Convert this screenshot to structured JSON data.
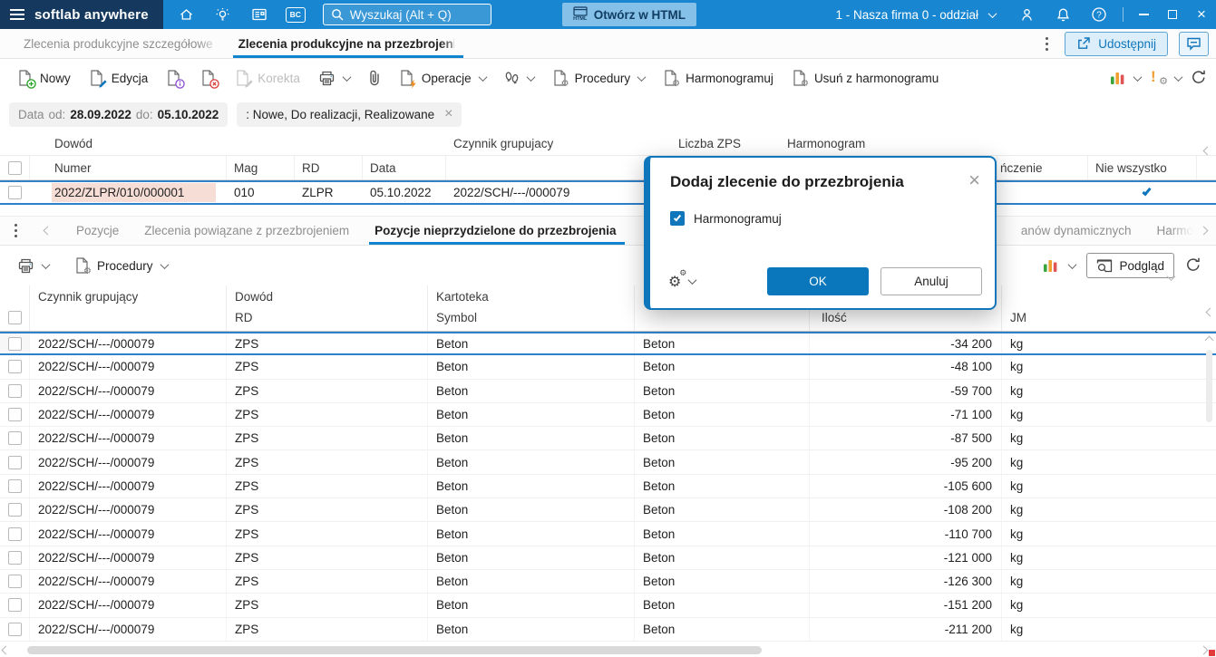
{
  "colors": {
    "topbar_blue": "#1886d0",
    "brand_dark": "#15395e",
    "accent_blue": "#1076bc",
    "tab_underline": "#1184cf",
    "selected_row_border": "#2e80c8",
    "highlight_pink": "#f6ded7",
    "chart_green": "#3aa53a",
    "chart_orange": "#f0a030",
    "chart_red": "#e05555"
  },
  "topbar": {
    "brand": "softlab anywhere",
    "search_placeholder": "Wyszukaj (Alt + Q)",
    "bc_label": "BC",
    "html_icon_label": "HTML",
    "open_html_label": "Otwórz w HTML",
    "company_selector": "1 - Nasza firma 0 - oddział"
  },
  "tabs": {
    "items": [
      {
        "label": "Zlecenia produkcyjne szczegółowe"
      },
      {
        "label": "Zlecenia produkcyjne na przezbrojenie"
      }
    ],
    "share_label": "Udostępnij"
  },
  "toolbar": {
    "nowy": "Nowy",
    "edycja": "Edycja",
    "korekta": "Korekta",
    "operacje": "Operacje",
    "procedury": "Procedury",
    "harmonogramuj": "Harmonogramuj",
    "usun": "Usuń z harmonogramu"
  },
  "filters": {
    "data_label": "Data",
    "od_label": "od:",
    "od_value": "28.09.2022",
    "do_label": "do:",
    "do_value": "05.10.2022",
    "status_value": ": Nowe, Do realizacji, Realizowane"
  },
  "upper_grid": {
    "group_headers": {
      "dowod": "Dowód",
      "czynnik": "Czynnik grupujacy",
      "liczba_zps": "Liczba ZPS",
      "harmonogram": "Harmonogram"
    },
    "sub_headers": {
      "numer": "Numer",
      "mag": "Mag",
      "rd": "RD",
      "data": "Data",
      "nczenie": "ńczenie",
      "nie_wszystko": "Nie wszystko"
    },
    "row": {
      "numer": "2022/ZLPR/010/000001",
      "mag": "010",
      "rd": "ZLPR",
      "data": "05.10.2022",
      "czynnik": "2022/SCH/---/000079"
    }
  },
  "modal": {
    "title": "Dodaj zlecenie do przezbrojenia",
    "checkbox_label": "Harmonogramuj",
    "ok_label": "OK",
    "cancel_label": "Anuluj"
  },
  "lower_tabs": {
    "items": [
      {
        "label": "Pozycje"
      },
      {
        "label": "Zlecenia powiązane z przezbrojeniem"
      },
      {
        "label": "Pozycje nieprzydzielone do przezbrojenia"
      },
      {
        "label": "anów dynamicznych"
      },
      {
        "label": "Harmo"
      }
    ]
  },
  "lower_toolbar": {
    "procedury": "Procedury",
    "podglad": "Podgląd"
  },
  "lower_grid": {
    "headers": {
      "czynnik": "Czynnik grupujący",
      "dowod": "Dowód",
      "rd": "RD",
      "kartoteka": "Kartoteka",
      "symbol": "Symbol",
      "ilosc": "Ilość",
      "jm": "JM"
    },
    "rows": [
      {
        "czynnik": "2022/SCH/---/000079",
        "rd": "ZPS",
        "symbol": "Beton",
        "nazwa": "Beton",
        "ilosc": "-34 200",
        "jm": "kg"
      },
      {
        "czynnik": "2022/SCH/---/000079",
        "rd": "ZPS",
        "symbol": "Beton",
        "nazwa": "Beton",
        "ilosc": "-48 100",
        "jm": "kg"
      },
      {
        "czynnik": "2022/SCH/---/000079",
        "rd": "ZPS",
        "symbol": "Beton",
        "nazwa": "Beton",
        "ilosc": "-59 700",
        "jm": "kg"
      },
      {
        "czynnik": "2022/SCH/---/000079",
        "rd": "ZPS",
        "symbol": "Beton",
        "nazwa": "Beton",
        "ilosc": "-71 100",
        "jm": "kg"
      },
      {
        "czynnik": "2022/SCH/---/000079",
        "rd": "ZPS",
        "symbol": "Beton",
        "nazwa": "Beton",
        "ilosc": "-87 500",
        "jm": "kg"
      },
      {
        "czynnik": "2022/SCH/---/000079",
        "rd": "ZPS",
        "symbol": "Beton",
        "nazwa": "Beton",
        "ilosc": "-95 200",
        "jm": "kg"
      },
      {
        "czynnik": "2022/SCH/---/000079",
        "rd": "ZPS",
        "symbol": "Beton",
        "nazwa": "Beton",
        "ilosc": "-105 600",
        "jm": "kg"
      },
      {
        "czynnik": "2022/SCH/---/000079",
        "rd": "ZPS",
        "symbol": "Beton",
        "nazwa": "Beton",
        "ilosc": "-108 200",
        "jm": "kg"
      },
      {
        "czynnik": "2022/SCH/---/000079",
        "rd": "ZPS",
        "symbol": "Beton",
        "nazwa": "Beton",
        "ilosc": "-110 700",
        "jm": "kg"
      },
      {
        "czynnik": "2022/SCH/---/000079",
        "rd": "ZPS",
        "symbol": "Beton",
        "nazwa": "Beton",
        "ilosc": "-121 000",
        "jm": "kg"
      },
      {
        "czynnik": "2022/SCH/---/000079",
        "rd": "ZPS",
        "symbol": "Beton",
        "nazwa": "Beton",
        "ilosc": "-126 300",
        "jm": "kg"
      },
      {
        "czynnik": "2022/SCH/---/000079",
        "rd": "ZPS",
        "symbol": "Beton",
        "nazwa": "Beton",
        "ilosc": "-151 200",
        "jm": "kg"
      },
      {
        "czynnik": "2022/SCH/---/000079",
        "rd": "ZPS",
        "symbol": "Beton",
        "nazwa": "Beton",
        "ilosc": "-211 200",
        "jm": "kg"
      }
    ]
  }
}
